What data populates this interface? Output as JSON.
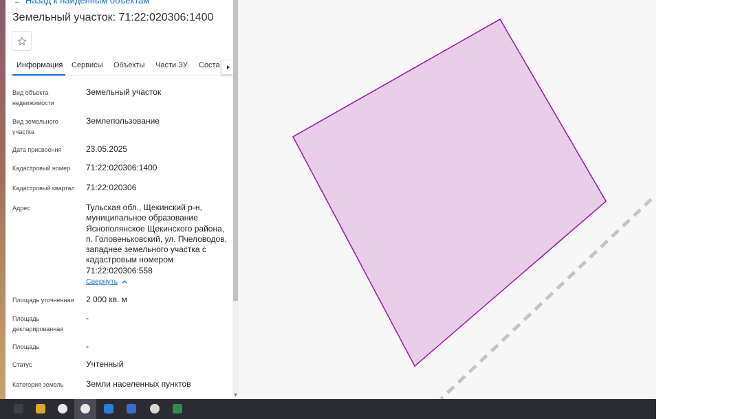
{
  "panel": {
    "back_link": "Назад к найденным объектам",
    "title": "Земельный участок: 71:22:020306:1400",
    "favorite_icon": "star-outline-icon",
    "tabs": [
      {
        "label": "Информация",
        "active": true
      },
      {
        "label": "Сервисы"
      },
      {
        "label": "Объекты"
      },
      {
        "label": "Части ЗУ"
      },
      {
        "label": "Соста"
      }
    ],
    "tabs_next_icon": "chevron-right-icon",
    "fields": [
      {
        "label": "Вид объекта недвижимости",
        "value": "Земельный участок"
      },
      {
        "label": "Вид земельного участка",
        "value": "Землепользование"
      },
      {
        "label": "Дата присвоения",
        "value": "23.05.2025"
      },
      {
        "label": "Кадастровый номер",
        "value": "71:22:020306:1400"
      },
      {
        "label": "Кадастровый квартал",
        "value": "71:22:020306"
      },
      {
        "label": "Адрес",
        "value": "Тульская обл., Щекинский р-н, муниципальное образование Яснополянское Щекинского района, п. Головеньковский, ул. Пчеловодов, западнее земельного участка с кадастровым номером 71:22:020306:558"
      },
      {
        "label": "Площадь уточненная",
        "value": "2 000 кв. м"
      },
      {
        "label": "Площадь декларированная",
        "value": "-"
      },
      {
        "label": "Площадь",
        "value": "-"
      },
      {
        "label": "Статус",
        "value": "Учтенный"
      },
      {
        "label": "Категория земель",
        "value": "Земли населенных пунктов"
      }
    ],
    "collapse_label": "Свернуть"
  },
  "map": {
    "parcel_fill": "#e8cde9",
    "parcel_stroke": "#9b22a6",
    "background": "#f7f7f7"
  },
  "colors": {
    "link": "#1b6fd1",
    "taskbar": "#2a2b33"
  }
}
